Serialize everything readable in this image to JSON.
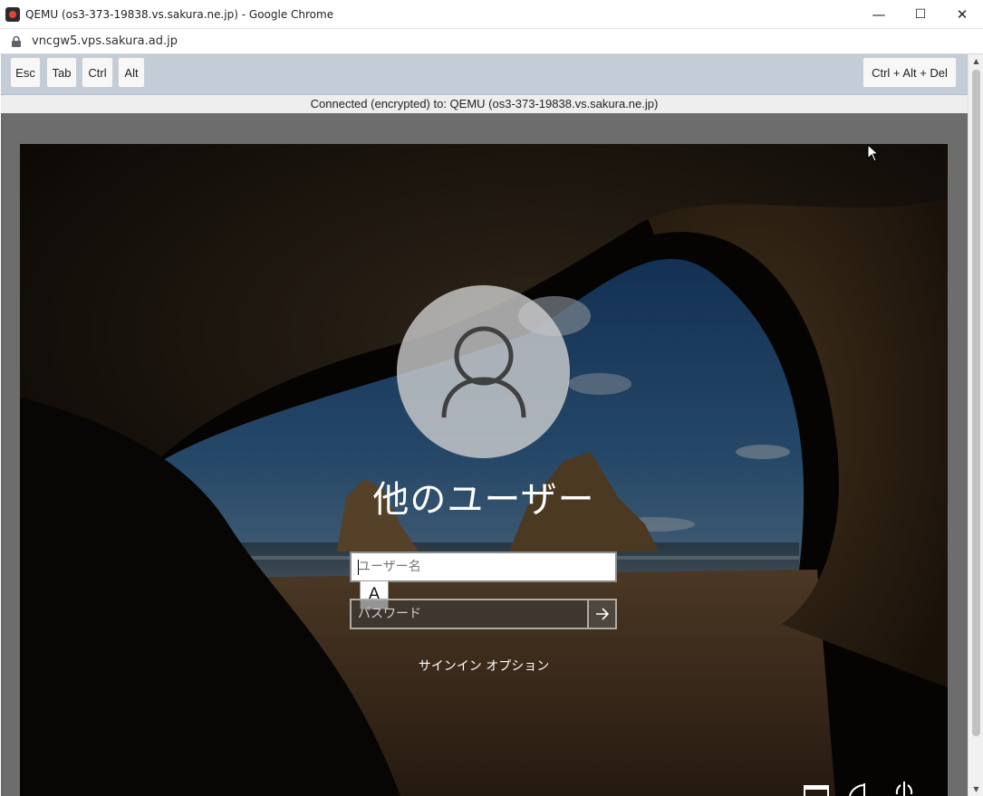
{
  "window": {
    "title": "QEMU (os3-373-19838.vs.sakura.ne.jp) - Google Chrome",
    "minimize": "—",
    "maximize": "☐",
    "close": "✕"
  },
  "address": {
    "url": "vncgw5.vps.sakura.ad.jp"
  },
  "toolbar": {
    "esc": "Esc",
    "tab": "Tab",
    "ctrl": "Ctrl",
    "alt": "Alt",
    "ctrl_alt_del": "Ctrl + Alt + Del"
  },
  "status": {
    "text": "Connected (encrypted) to: QEMU (os3-373-19838.vs.sakura.ne.jp)"
  },
  "login": {
    "user_title": "他のユーザー",
    "username_placeholder": "ユーザー名",
    "password_placeholder": "パスワード",
    "ime_indicator": "A",
    "signin_options": "サインイン オプション"
  }
}
